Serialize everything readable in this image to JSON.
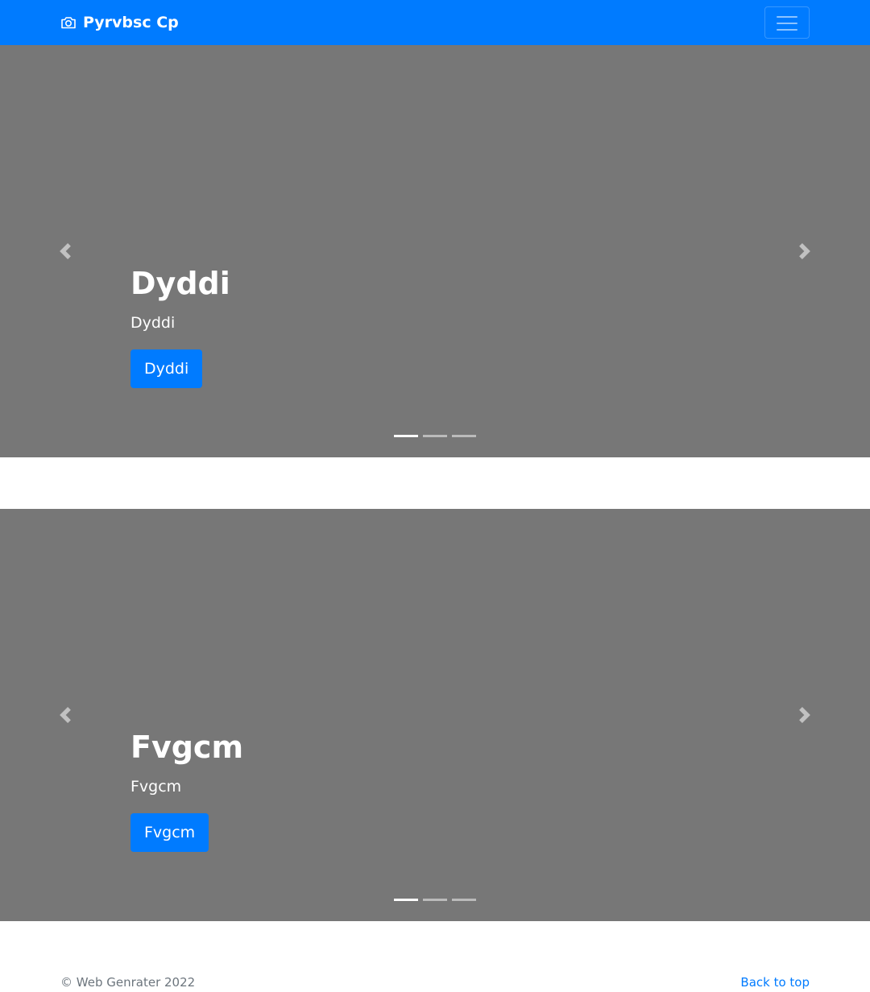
{
  "navbar": {
    "brand": "Pyrvbsc Cp",
    "brand_icon": "camera-icon",
    "toggler_icon": "hamburger-menu-icon",
    "background": "#007bff"
  },
  "carousels": [
    {
      "title": "Dyddi",
      "text": "Dyddi",
      "button": "Dyddi",
      "indicator_count": 3,
      "active_indicator": 1
    },
    {
      "title": "Fvgcm",
      "text": "Fvgcm",
      "button": "Fvgcm",
      "indicator_count": 3,
      "active_indicator": 1
    }
  ],
  "controls": {
    "prev_icon": "chevron-left-icon",
    "next_icon": "chevron-right-icon"
  },
  "footer": {
    "copyright": "© Web Genrater 2022",
    "back_to_top": "Back to top"
  },
  "colors": {
    "primary": "#007bff",
    "slide_background": "#777777",
    "muted_text": "#6c757d"
  }
}
